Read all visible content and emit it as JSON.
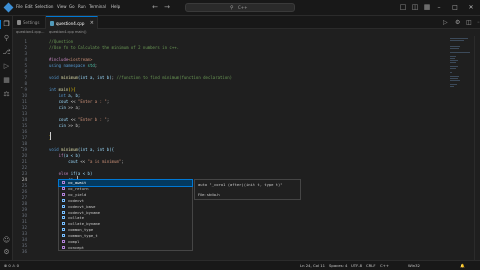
{
  "window": {
    "menu": [
      "File",
      "Edit",
      "Selection",
      "View",
      "Go",
      "Run",
      "Terminal",
      "Help"
    ],
    "search_label": "C++"
  },
  "tabs": [
    {
      "label": "Settings",
      "active": false
    },
    {
      "label": "question4.cpp",
      "active": true
    }
  ],
  "breadcrumb": [
    "question4.cpp",
    "…",
    "question4.cpp",
    "main()"
  ],
  "editor": {
    "line_numbers": [
      "1",
      "2",
      "3",
      "4",
      "5",
      "6",
      "7",
      "8",
      "9",
      "10",
      "11",
      "12",
      "13",
      "14",
      "15",
      "16",
      "17",
      "18",
      "19",
      "20",
      "21",
      "22",
      "23",
      "24",
      "25",
      "26",
      "27",
      "28",
      "29",
      "30",
      "31",
      "32",
      "33",
      "34",
      "35",
      "36"
    ],
    "active_line": "24",
    "lines": [
      [
        {
          "t": "//Question",
          "c": "c-cm"
        }
      ],
      [
        {
          "t": "//Use fn to Calculate the minimum of 2 numbers in c++.",
          "c": "c-cm"
        }
      ],
      [],
      [
        {
          "t": "#include",
          "c": "c-pp"
        },
        {
          "t": "<iostream>",
          "c": "c-st"
        }
      ],
      [
        {
          "t": "using ",
          "c": "c-kw"
        },
        {
          "t": "namespace ",
          "c": "c-kw"
        },
        {
          "t": "std",
          "c": "c-ty"
        },
        {
          "t": ";",
          "c": "c-pl"
        }
      ],
      [],
      [
        {
          "t": "void ",
          "c": "c-kw"
        },
        {
          "t": "minimum",
          "c": "c-fn"
        },
        {
          "t": "(int a, int b)",
          "c": "c-id"
        },
        {
          "t": "; ",
          "c": "c-pl"
        },
        {
          "t": "//function to find minimum(function declaration)",
          "c": "c-cm"
        }
      ],
      [],
      [
        {
          "t": "int ",
          "c": "c-kw"
        },
        {
          "t": "main",
          "c": "c-fn"
        },
        {
          "t": "(){",
          "c": "c-pn"
        }
      ],
      [
        {
          "t": "    int ",
          "c": "c-kw"
        },
        {
          "t": "a, b;",
          "c": "c-id"
        }
      ],
      [
        {
          "t": "    cout ",
          "c": "c-id"
        },
        {
          "t": "<< ",
          "c": "c-pl"
        },
        {
          "t": "\"Enter a : \"",
          "c": "c-st"
        },
        {
          "t": ";",
          "c": "c-pl"
        }
      ],
      [
        {
          "t": "    cin ",
          "c": "c-id"
        },
        {
          "t": ">> a;",
          "c": "c-pl"
        }
      ],
      [],
      [
        {
          "t": "    cout ",
          "c": "c-id"
        },
        {
          "t": "<< ",
          "c": "c-pl"
        },
        {
          "t": "\"Enter b : \"",
          "c": "c-st"
        },
        {
          "t": ";",
          "c": "c-pl"
        }
      ],
      [
        {
          "t": "    cin ",
          "c": "c-id"
        },
        {
          "t": ">> b;",
          "c": "c-pl"
        }
      ],
      [],
      [
        {
          "t": "}",
          "c": "c-pn"
        }
      ],
      [],
      [
        {
          "t": "void ",
          "c": "c-kw"
        },
        {
          "t": "minimum",
          "c": "c-fn"
        },
        {
          "t": "(int a, int b){",
          "c": "c-id"
        }
      ],
      [
        {
          "t": "    if",
          "c": "c-pp"
        },
        {
          "t": "(a < b)",
          "c": "c-id"
        }
      ],
      [
        {
          "t": "        cout ",
          "c": "c-id"
        },
        {
          "t": "<< ",
          "c": "c-pl"
        },
        {
          "t": "\"a is minimum\"",
          "c": "c-st"
        },
        {
          "t": ";",
          "c": "c-pl"
        }
      ],
      [],
      [
        {
          "t": "    else ",
          "c": "c-pp"
        },
        {
          "t": "if(a < b)",
          "c": "c-id"
        }
      ],
      [
        {
          "t": "        co",
          "c": "c-id"
        }
      ],
      [],
      [],
      [],
      [],
      [],
      [],
      [],
      [],
      [],
      [],
      [],
      []
    ]
  },
  "suggestions": [
    {
      "label": "co_await",
      "match": "co",
      "kind": "kw",
      "selected": true
    },
    {
      "label": "co_return",
      "match": "co",
      "kind": "kw",
      "selected": false
    },
    {
      "label": "co_yield",
      "match": "co",
      "kind": "kw",
      "selected": false
    },
    {
      "label": "codecvt",
      "match": "co",
      "kind": "cls",
      "selected": false
    },
    {
      "label": "codecvt_base",
      "match": "co",
      "kind": "cls",
      "selected": false
    },
    {
      "label": "codecvt_byname",
      "match": "co",
      "kind": "cls",
      "selected": false
    },
    {
      "label": "collate",
      "match": "co",
      "kind": "cls",
      "selected": false
    },
    {
      "label": "collate_byname",
      "match": "co",
      "kind": "cls",
      "selected": false
    },
    {
      "label": "common_type",
      "match": "co",
      "kind": "cls",
      "selected": false
    },
    {
      "label": "common_type_t",
      "match": "co",
      "kind": "cls",
      "selected": false
    },
    {
      "label": "compl",
      "match": "co",
      "kind": "kw",
      "selected": false
    },
    {
      "label": "concept",
      "match": "co",
      "kind": "kw",
      "selected": false
    }
  ],
  "suggest_detail": {
    "signature": "auto \"_coro1 (after)(init t, type t)\"",
    "file": "File: stdio.h"
  },
  "status": {
    "position": "Ln 24, Col 11",
    "spaces": "Spaces: 4",
    "encoding": "UTF-8",
    "eol": "CRLF",
    "language": "C++",
    "platform": "Win32"
  }
}
